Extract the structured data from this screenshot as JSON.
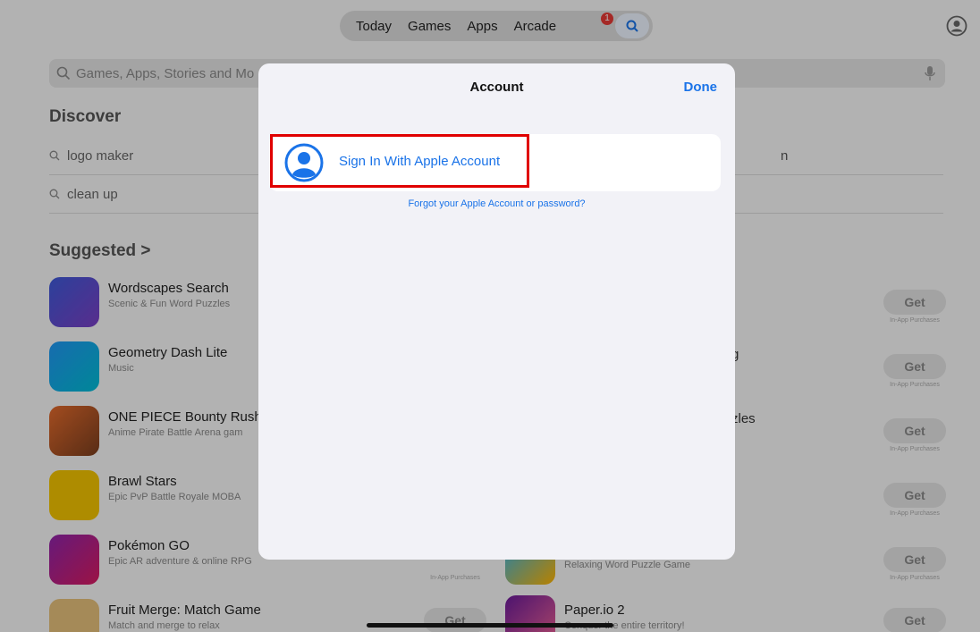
{
  "topnav": {
    "tabs": [
      "Today",
      "Games",
      "Apps",
      "Arcade"
    ],
    "arcade_badge": "1"
  },
  "search": {
    "placeholder": "Games, Apps, Stories and Mo"
  },
  "discover": {
    "title": "Discover",
    "items": [
      "logo maker",
      "clean up"
    ],
    "right_fragment": "n"
  },
  "suggested": {
    "title": "Suggested >",
    "left_apps": [
      {
        "name": "Wordscapes Search",
        "subtitle": "Scenic & Fun Word Puzzles"
      },
      {
        "name": "Geometry Dash Lite",
        "subtitle": "Music"
      },
      {
        "name": "ONE PIECE Bounty Rush",
        "subtitle": "Anime Pirate Battle Arena gam"
      },
      {
        "name": "Brawl Stars",
        "subtitle": "Epic PvP Battle Royale MOBA"
      },
      {
        "name": "Pokémon GO",
        "subtitle": "Epic AR adventure & online RPG"
      },
      {
        "name": "Fruit Merge: Match Game",
        "subtitle": "Match and merge to relax"
      }
    ],
    "right_fragments": [
      "g",
      "zles"
    ],
    "right_apps": [
      {
        "name": "",
        "subtitle": "Relaxing Word Puzzle Game"
      },
      {
        "name": "Paper.io 2",
        "subtitle": "Conquer the entire territory!"
      }
    ],
    "get_label": "Get",
    "in_app_label": "In-App Purchases"
  },
  "modal": {
    "title": "Account",
    "done_label": "Done",
    "signin_label": "Sign In With Apple Account",
    "forgot_label": "Forgot your Apple Account or password?"
  },
  "colors": {
    "accent": "#1a73e8",
    "highlight": "#e00000"
  }
}
